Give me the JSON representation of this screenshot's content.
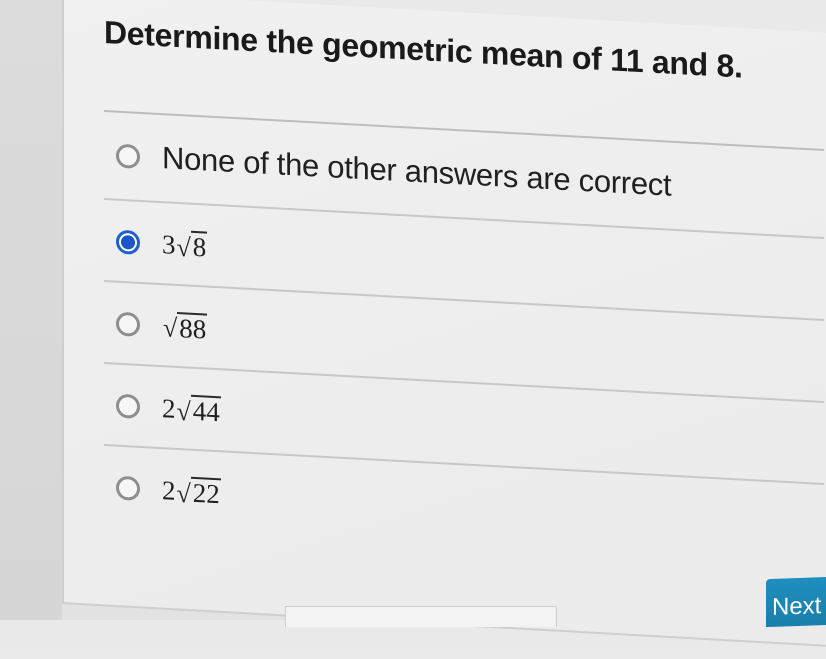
{
  "question": {
    "prompt": "Determine the geometric mean of 11 and 8."
  },
  "choices": [
    {
      "label": "None of the other answers are correct",
      "selected": false
    },
    {
      "coefficient": "3",
      "radicand": "8",
      "selected": true
    },
    {
      "coefficient": "",
      "radicand": "88",
      "selected": false
    },
    {
      "coefficient": "2",
      "radicand": "44",
      "selected": false
    },
    {
      "coefficient": "2",
      "radicand": "22",
      "selected": false
    }
  ],
  "navigation": {
    "next_label": "Next"
  },
  "colors": {
    "selected_radio": "#1a56c9",
    "next_button": "#1f8fbf"
  }
}
